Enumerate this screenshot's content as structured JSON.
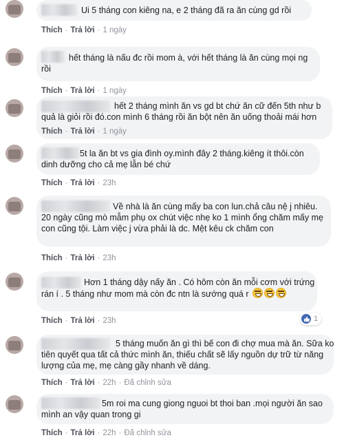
{
  "labels": {
    "like": "Thích",
    "reply": "Trả lời",
    "edited": "Đã chỉnh sửa"
  },
  "comments": [
    {
      "text": "Ui 5 tháng con kiêng na, e 2 tháng đã ra ăn cùng gd rồi",
      "time": "1 ngày"
    },
    {
      "text": "hết tháng là nấu đc rồi mom à, với hết tháng là ăn cùng mọi ng rồi",
      "time": "1 ngày"
    },
    {
      "text": "hết 2 tháng mình ăn vs gd bt chứ ăn cữ đến 5th như b quả là giỏi rồi đó.con mình 6 tháng rồi ăn bột nên ăn uống thoải mái hơn",
      "time": "1 ngày"
    },
    {
      "text": "5t la ăn bt vs gia đình oy.mình đây 2 tháng.kiêng ít thôi.còn dinh dưỡng cho cả mẹ lẫn bé chứ",
      "time": "23h"
    },
    {
      "text": "Về nhà là ăn cùng mấy ba con lun.chả câu nệ j nhiêu. 20 ngày cũng mò mẫm phụ ox chút việc nhẹ ko 1 mình ổng chăm mấy mẹ con cũng tội. Làm việc j vừa phải là dc. Mệt kêu ck chăm con",
      "time": "23h"
    },
    {
      "text": "Hơn 1 tháng dậy nấy ăn . Có hôm còn ăn mỗi cơm với trứng rán í . 5 tháng như mom mà còn đc ntn là sướng quá r",
      "time": "23h",
      "reaction_count": "1"
    },
    {
      "text": "5 tháng muốn ăn gì thì bế con đi chợ mua mà ăn. Sữa ko tiên quyết qua tất cả thức mình ăn, thiếu chất sẽ lấy nguồn dự trữ từ năng lượng của mẹ, mẹ càng gầy nhanh về dáng.",
      "time": "22h"
    },
    {
      "text": "5m roi ma cung giong nguoi bt thoi ban .mọi người ăn sao mình an vậy quan trong gi",
      "time": "22h"
    }
  ]
}
